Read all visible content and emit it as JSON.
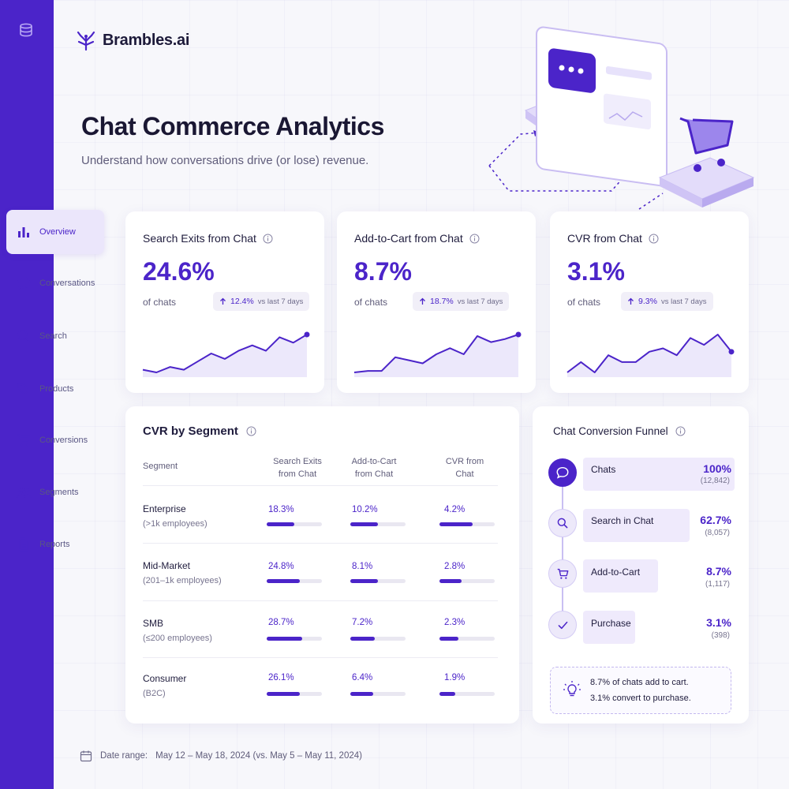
{
  "brand": {
    "name": "Brambles.ai"
  },
  "header": {
    "title": "Chat Commerce Analytics",
    "subtitle": "Understand how conversations drive (or lose) revenue."
  },
  "sidebar": {
    "items": [
      {
        "label": "Overview",
        "icon": "bar-chart-icon",
        "active": true
      },
      {
        "label": "Conversations",
        "icon": "chat-bubble-icon"
      },
      {
        "label": "Search",
        "icon": "search-icon"
      },
      {
        "label": "Products",
        "icon": "tag-icon"
      },
      {
        "label": "Conversions",
        "icon": "cart-icon"
      },
      {
        "label": "Segments",
        "icon": "users-icon"
      },
      {
        "label": "Reports",
        "icon": "document-icon"
      }
    ]
  },
  "kpis": [
    {
      "title": "Search Exits from Chat",
      "value": "24.6%",
      "sub": "of chats",
      "delta": "12.4%",
      "vs": "vs last 7 days",
      "trend": [
        8,
        6,
        10,
        8,
        14,
        20,
        16,
        22,
        26,
        22,
        32,
        28,
        34
      ]
    },
    {
      "title": "Add-to-Cart from Chat",
      "value": "8.7%",
      "sub": "of chats",
      "delta": "18.7%",
      "vs": "vs last 7 days",
      "trend": [
        6,
        7,
        7,
        16,
        14,
        12,
        18,
        22,
        18,
        30,
        26,
        28,
        31
      ]
    },
    {
      "title": "CVR from Chat",
      "value": "3.1%",
      "sub": "of chats",
      "delta": "9.3%",
      "vs": "vs last 7 days",
      "trend": [
        14,
        20,
        14,
        24,
        20,
        20,
        26,
        28,
        24,
        34,
        30,
        36,
        26
      ]
    }
  ],
  "segments": {
    "title": "CVR by Segment",
    "headers": {
      "segment": "Segment",
      "col1a": "Search Exits",
      "col1b": "from Chat",
      "col2a": "Add-to-Cart",
      "col2b": "from Chat",
      "col3a": "CVR from",
      "col3b": "Chat"
    },
    "rows": [
      {
        "name": "Enterprise",
        "desc": "(>1k employees)",
        "search": "18.3%",
        "cart": "10.2%",
        "cvr": "4.2%",
        "search_frac": 0.5,
        "cart_frac": 0.5,
        "cvr_frac": 0.6
      },
      {
        "name": "Mid-Market",
        "desc": "(201–1k employees)",
        "search": "24.8%",
        "cart": "8.1%",
        "cvr": "2.8%",
        "search_frac": 0.6,
        "cart_frac": 0.5,
        "cvr_frac": 0.4
      },
      {
        "name": "SMB",
        "desc": "(≤200 employees)",
        "search": "28.7%",
        "cart": "7.2%",
        "cvr": "2.3%",
        "search_frac": 0.64,
        "cart_frac": 0.44,
        "cvr_frac": 0.34
      },
      {
        "name": "Consumer",
        "desc": "(B2C)",
        "search": "26.1%",
        "cart": "6.4%",
        "cvr": "1.9%",
        "search_frac": 0.6,
        "cart_frac": 0.42,
        "cvr_frac": 0.28
      }
    ]
  },
  "funnel": {
    "title": "Chat Conversion Funnel",
    "stages": [
      {
        "label": "Chats",
        "pct": "100%",
        "count": "(12,842)",
        "icon": "chat-bubble-icon",
        "frac": 1.0
      },
      {
        "label": "Search in Chat",
        "pct": "62.7%",
        "count": "(8,057)",
        "icon": "search-icon",
        "frac": 0.627
      },
      {
        "label": "Add-to-Cart",
        "pct": "8.7%",
        "count": "(1,117)",
        "icon": "cart-icon",
        "frac": 0.087
      },
      {
        "label": "Purchase",
        "pct": "3.1%",
        "count": "(398)",
        "icon": "check-icon",
        "frac": 0.031
      }
    ],
    "insight_line1": "8.7% of chats add to cart.",
    "insight_line2": "3.1% convert to purchase."
  },
  "footer": {
    "label": "Date range:",
    "value": "May 12 – May 18, 2024 (vs. May 5 – May 11, 2024)"
  },
  "colors": {
    "accent": "#4b24c9",
    "sidebar": "#4b24c9",
    "background": "#f7f7fb"
  }
}
